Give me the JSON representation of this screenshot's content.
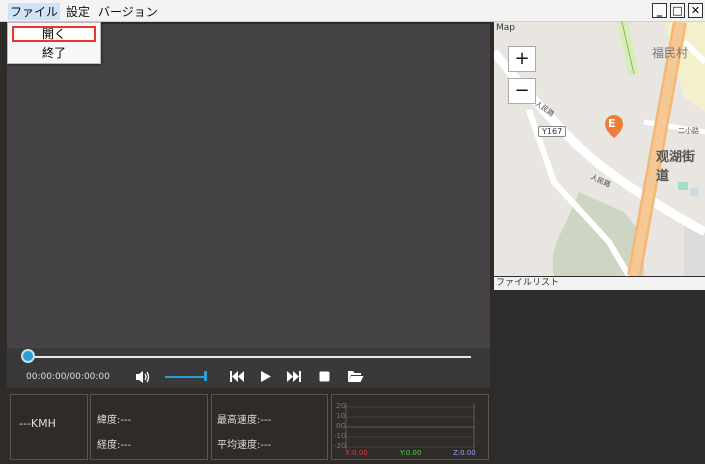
{
  "menu": {
    "items": [
      "ファイル",
      "設定",
      "バージョン"
    ]
  },
  "window_controls": {
    "minimize": "_",
    "maximize": "□",
    "close": "✕"
  },
  "file_menu": {
    "items": [
      "開く",
      "終了"
    ]
  },
  "player": {
    "time": "00:00:00/00:00:00",
    "progress": 0,
    "volume": 1.0
  },
  "panels": {
    "speed": "---KMH",
    "lat": "緯度:---",
    "lon": "経度:---",
    "max_speed": "最高速度:---",
    "avg_speed": "平均速度:---"
  },
  "gsensor": {
    "ticks": [
      "2G",
      "1G",
      "0G",
      "-1G",
      "-2G"
    ],
    "x": "X:0.00",
    "y": "Y:0.00",
    "z": "Z:0.00",
    "colors": {
      "x": "#e23a3a",
      "y": "#4fd14f",
      "z": "#9aa0ff"
    }
  },
  "map": {
    "title": "Map",
    "zoom_in": "+",
    "zoom_out": "−",
    "labels": {
      "village": "福民村",
      "street": "观湖街道",
      "road_code": "Y167",
      "road1": "人民路",
      "road2": "人民路",
      "minor": "二小路",
      "marker": "E"
    }
  },
  "filelist": {
    "title": "ファイルリスト"
  },
  "colors": {
    "accent": "#2b9ed8",
    "menu_highlight": "#cfe3f7",
    "selection_border": "#e33333",
    "marker": "#ef7d3a"
  }
}
